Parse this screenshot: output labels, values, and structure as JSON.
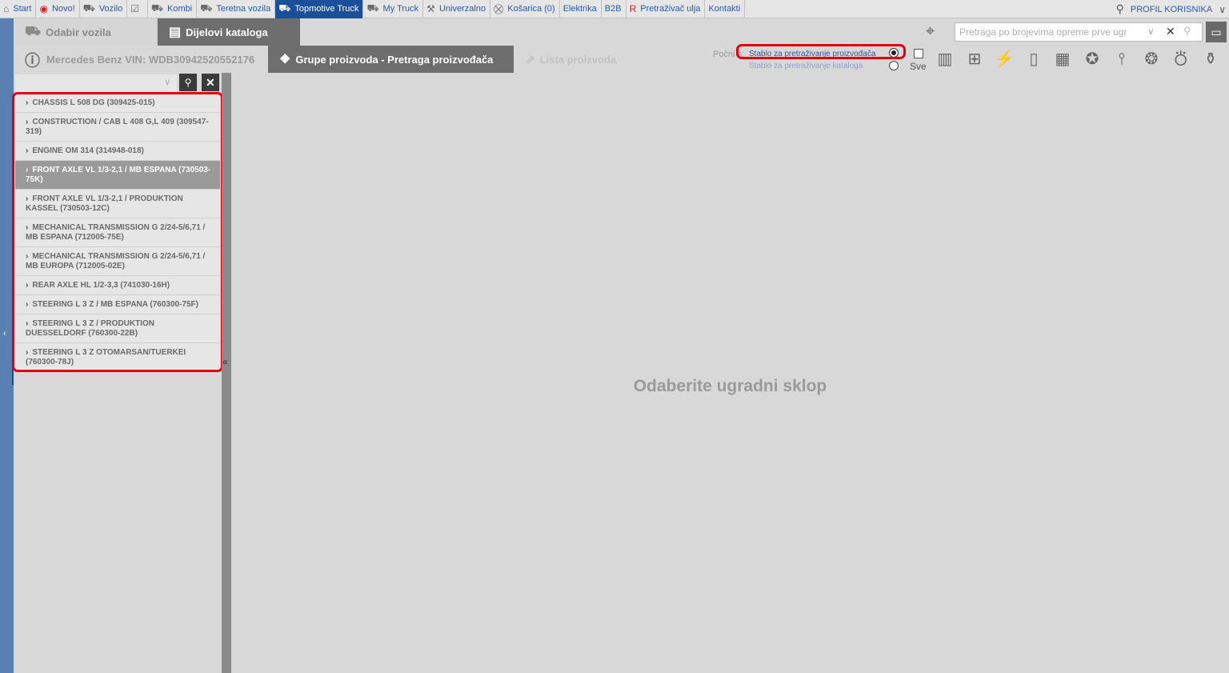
{
  "nav": {
    "items": [
      {
        "label": "Start",
        "icon": "home-icon",
        "glyph": "⌂"
      },
      {
        "label": "Novo!",
        "icon": "new-badge-icon",
        "glyph": "◉"
      },
      {
        "label": "Vozilo",
        "icon": "car-icon",
        "glyph": "⛟"
      },
      {
        "label": "",
        "icon": "checkbox-icon",
        "glyph": "☑"
      },
      {
        "label": "Kombi",
        "icon": "van-icon",
        "glyph": "⛟"
      },
      {
        "label": "Teretna vozila",
        "icon": "truck-icon",
        "glyph": "⛟"
      },
      {
        "label": "Topmotive Truck",
        "icon": "topmotive-truck-icon",
        "glyph": "⛟"
      },
      {
        "label": "My Truck",
        "icon": "my-truck-icon",
        "glyph": "⛟"
      },
      {
        "label": "Univerzalno",
        "icon": "universal-icon",
        "glyph": "⚒"
      },
      {
        "label": "Košarica (0)",
        "icon": "cart-icon",
        "glyph": "⛒"
      },
      {
        "label": "Elektrika",
        "icon": "",
        "glyph": ""
      },
      {
        "label": "B2B",
        "icon": "",
        "glyph": ""
      },
      {
        "label": "Pretraživač ulja",
        "icon": "oil-search-icon",
        "glyph": "R"
      },
      {
        "label": "Kontakti",
        "icon": "",
        "glyph": ""
      }
    ],
    "profile": "PROFIL KORISNIKA"
  },
  "row1": {
    "vehicle_tab": "Odabir vozila",
    "catalog_tab": "Dijelovi kataloga",
    "oe_search_placeholder": "Pretraga po brojevima opreme prve ugr"
  },
  "row2": {
    "vin": "Mercedes Benz VIN: WDB30942520552176",
    "groups_tab": "Grupe proizvoda - Pretraga proizvođača",
    "list_tab": "Lista proizvoda",
    "start_label": "Počni s:",
    "tree_manufacturer": "Stablo za pretraživanje proizvođača",
    "tree_catalog": "Stablo za pretraživanje kataloga",
    "all_label": "Sve"
  },
  "groups": [
    {
      "label": "CHASSIS L 508 DG (309425-015)",
      "selected": false
    },
    {
      "label": "CONSTRUCTION / CAB L 408 G,L 409 (309547-319)",
      "selected": false
    },
    {
      "label": "ENGINE OM 314 (314948-018)",
      "selected": false
    },
    {
      "label": "FRONT AXLE VL 1/3-2,1 / MB ESPANA (730503-75K)",
      "selected": true
    },
    {
      "label": "FRONT AXLE VL 1/3-2,1 / PRODUKTION KASSEL (730503-12C)",
      "selected": false
    },
    {
      "label": "MECHANICAL TRANSMISSION G 2/24-5/6,71 / MB ESPANA (712005-75E)",
      "selected": false
    },
    {
      "label": "MECHANICAL TRANSMISSION G 2/24-5/6,71 / MB EUROPA (712005-02E)",
      "selected": false
    },
    {
      "label": "REAR AXLE HL 1/2-3,3 (741030-16H)",
      "selected": false
    },
    {
      "label": "STEERING L 3 Z / MB ESPANA (760300-75F)",
      "selected": false
    },
    {
      "label": "STEERING L 3 Z / PRODUKTION DUESSELDORF (760300-22B)",
      "selected": false
    },
    {
      "label": "STEERING L 3 Z OTOMARSAN/TUERKEI (760300-78J)",
      "selected": false
    }
  ],
  "main": {
    "message": "Odaberite ugradni sklop"
  },
  "colors": {
    "nav_active": "#1a4f9c",
    "annotation": "#e00010",
    "dark_tab": "#6e6e6e"
  }
}
